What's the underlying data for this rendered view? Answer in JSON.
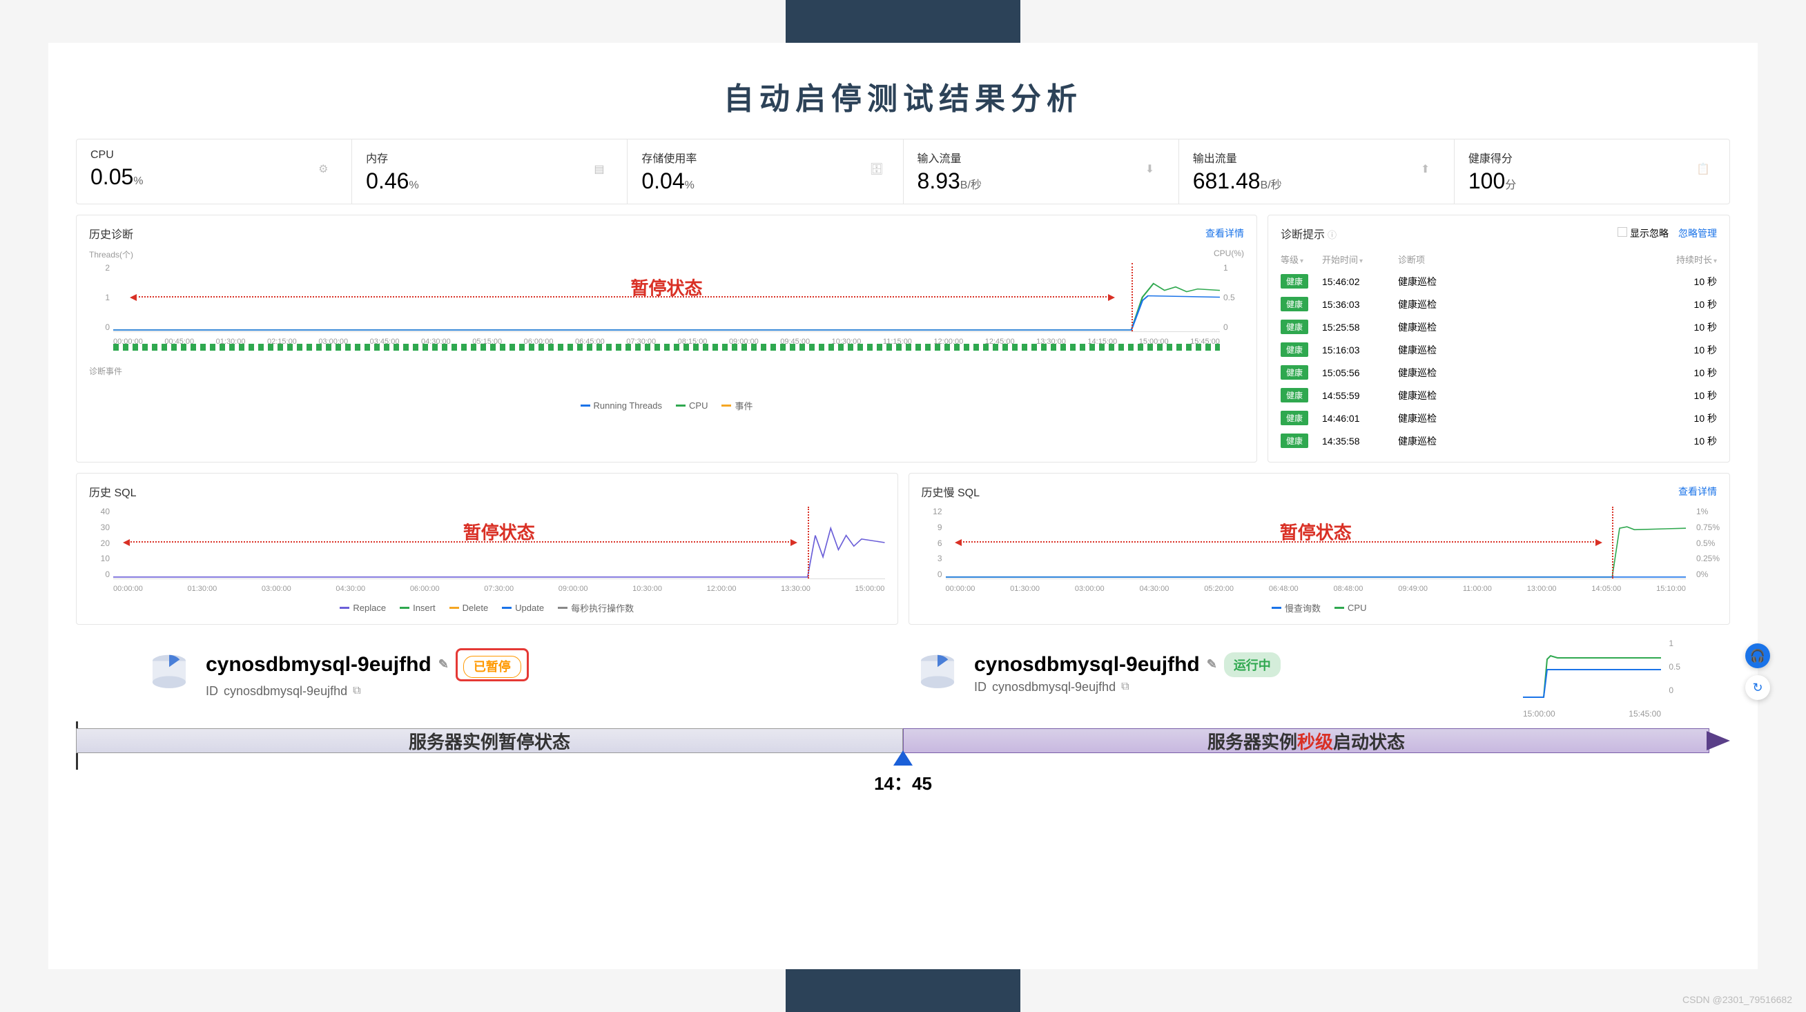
{
  "title": "自动启停测试结果分析",
  "metrics": [
    {
      "label": "CPU",
      "value": "0.05",
      "unit": "%",
      "icon": "cpu"
    },
    {
      "label": "内存",
      "value": "0.46",
      "unit": "%",
      "icon": "memory"
    },
    {
      "label": "存储使用率",
      "value": "0.04",
      "unit": "%",
      "icon": "storage"
    },
    {
      "label": "输入流量",
      "value": "8.93",
      "unit": "B/秒",
      "icon": "in"
    },
    {
      "label": "输出流量",
      "value": "681.48",
      "unit": "B/秒",
      "icon": "out"
    },
    {
      "label": "健康得分",
      "value": "100",
      "unit": "分",
      "icon": "health"
    }
  ],
  "history_diag": {
    "title": "历史诊断",
    "link": "查看详情",
    "y_left_label": "Threads(个)",
    "y_right_label": "CPU(%)",
    "y_left": [
      "2",
      "1",
      "0"
    ],
    "y_right": [
      "1",
      "0.5",
      "0"
    ],
    "x": [
      "00:00:00",
      "00:45:00",
      "01:30:00",
      "02:15:00",
      "03:00:00",
      "03:45:00",
      "04:30:00",
      "05:15:00",
      "06:00:00",
      "06:45:00",
      "07:30:00",
      "08:15:00",
      "09:00:00",
      "09:45:00",
      "10:30:00",
      "11:15:00",
      "12:00:00",
      "12:45:00",
      "13:30:00",
      "14:15:00",
      "15:00:00",
      "15:45:00"
    ],
    "pause_label": "暂停状态",
    "events_label": "诊断事件",
    "legend": [
      {
        "c": "#1a73e8",
        "t": "Running Threads"
      },
      {
        "c": "#2fa84f",
        "t": "CPU"
      },
      {
        "c": "#f5a623",
        "t": "事件"
      }
    ]
  },
  "diag_tips": {
    "title": "诊断提示",
    "show_ignore": "显示忽略",
    "ignore_link": "忽略管理",
    "cols": {
      "level": "等级",
      "start": "开始时间",
      "item": "诊断项",
      "dur": "持续时长"
    },
    "rows": [
      {
        "level": "健康",
        "time": "15:46:02",
        "item": "健康巡检",
        "dur": "10 秒"
      },
      {
        "level": "健康",
        "time": "15:36:03",
        "item": "健康巡检",
        "dur": "10 秒"
      },
      {
        "level": "健康",
        "time": "15:25:58",
        "item": "健康巡检",
        "dur": "10 秒"
      },
      {
        "level": "健康",
        "time": "15:16:03",
        "item": "健康巡检",
        "dur": "10 秒"
      },
      {
        "level": "健康",
        "time": "15:05:56",
        "item": "健康巡检",
        "dur": "10 秒"
      },
      {
        "level": "健康",
        "time": "14:55:59",
        "item": "健康巡检",
        "dur": "10 秒"
      },
      {
        "level": "健康",
        "time": "14:46:01",
        "item": "健康巡检",
        "dur": "10 秒"
      },
      {
        "level": "健康",
        "time": "14:35:58",
        "item": "健康巡检",
        "dur": "10 秒"
      }
    ]
  },
  "history_sql": {
    "title": "历史 SQL",
    "y": [
      "40",
      "30",
      "20",
      "10",
      "0"
    ],
    "x": [
      "00:00:00",
      "01:30:00",
      "03:00:00",
      "04:30:00",
      "06:00:00",
      "07:30:00",
      "09:00:00",
      "10:30:00",
      "12:00:00",
      "13:30:00",
      "15:00:00"
    ],
    "pause_label": "暂停状态",
    "legend": [
      {
        "c": "#6b5fd8",
        "t": "Replace"
      },
      {
        "c": "#2fa84f",
        "t": "Insert"
      },
      {
        "c": "#f5a623",
        "t": "Delete"
      },
      {
        "c": "#1a73e8",
        "t": "Update"
      },
      {
        "c": "#888",
        "t": "每秒执行操作数"
      }
    ]
  },
  "slow_sql": {
    "title": "历史慢 SQL",
    "link": "查看详情",
    "y_left": [
      "12",
      "9",
      "6",
      "3",
      "0"
    ],
    "y_right": [
      "1%",
      "0.75%",
      "0.5%",
      "0.25%",
      "0%"
    ],
    "x": [
      "00:00:00",
      "01:30:00",
      "03:00:00",
      "04:30:00",
      "05:20:00",
      "06:48:00",
      "08:48:00",
      "09:49:00",
      "11:00:00",
      "13:00:00",
      "14:05:00",
      "15:10:00"
    ],
    "pause_label": "暂停状态",
    "legend": [
      {
        "c": "#1a73e8",
        "t": "慢查询数"
      },
      {
        "c": "#2fa84f",
        "t": "CPU"
      }
    ]
  },
  "instances": {
    "left": {
      "name": "cynosdbmysql-9eujfhd",
      "id_label": "ID",
      "id": "cynosdbmysql-9eujfhd",
      "status": "已暂停"
    },
    "right": {
      "name": "cynosdbmysql-9eujfhd",
      "id_label": "ID",
      "id": "cynosdbmysql-9eujfhd",
      "status": "运行中",
      "mini_x": [
        "15:00:00",
        "15:45:00"
      ],
      "mini_y": [
        "1",
        "0.5",
        "0"
      ]
    }
  },
  "timeline": {
    "left": "服务器实例暂停状态",
    "right_pre": "服务器实例",
    "right_hl": "秒级",
    "right_post": "启动状态",
    "time": "14：45"
  },
  "watermark": "CSDN @2301_79516682",
  "chart_data": [
    {
      "type": "line",
      "title": "历史诊断",
      "x_range": [
        "00:00:00",
        "15:45:00"
      ],
      "series": [
        {
          "name": "Running Threads",
          "values_note": "~0 until 14:45 then ~1"
        },
        {
          "name": "CPU",
          "values_note": "~0 until 14:45 then ~0.7"
        }
      ],
      "y_left": [
        0,
        2
      ],
      "y_right": [
        0,
        1
      ],
      "pause_region": [
        "00:00:00",
        "14:45:00"
      ]
    },
    {
      "type": "line",
      "title": "历史 SQL",
      "x_range": [
        "00:00:00",
        "15:00:00"
      ],
      "series": [
        {
          "name": "Replace"
        },
        {
          "name": "Insert"
        },
        {
          "name": "Delete"
        },
        {
          "name": "Update"
        },
        {
          "name": "每秒执行操作数"
        }
      ],
      "ylim": [
        0,
        40
      ],
      "values_note": "all ~0 until 14:45 then spike ~20-30"
    },
    {
      "type": "line",
      "title": "历史慢 SQL",
      "x_range": [
        "00:00:00",
        "15:10:00"
      ],
      "series": [
        {
          "name": "慢查询数"
        },
        {
          "name": "CPU"
        }
      ],
      "y_left": [
        0,
        12
      ],
      "y_right": [
        "0%",
        "1%"
      ],
      "values_note": "~0 until 14:45 then CPU rises ~0.75%"
    }
  ]
}
